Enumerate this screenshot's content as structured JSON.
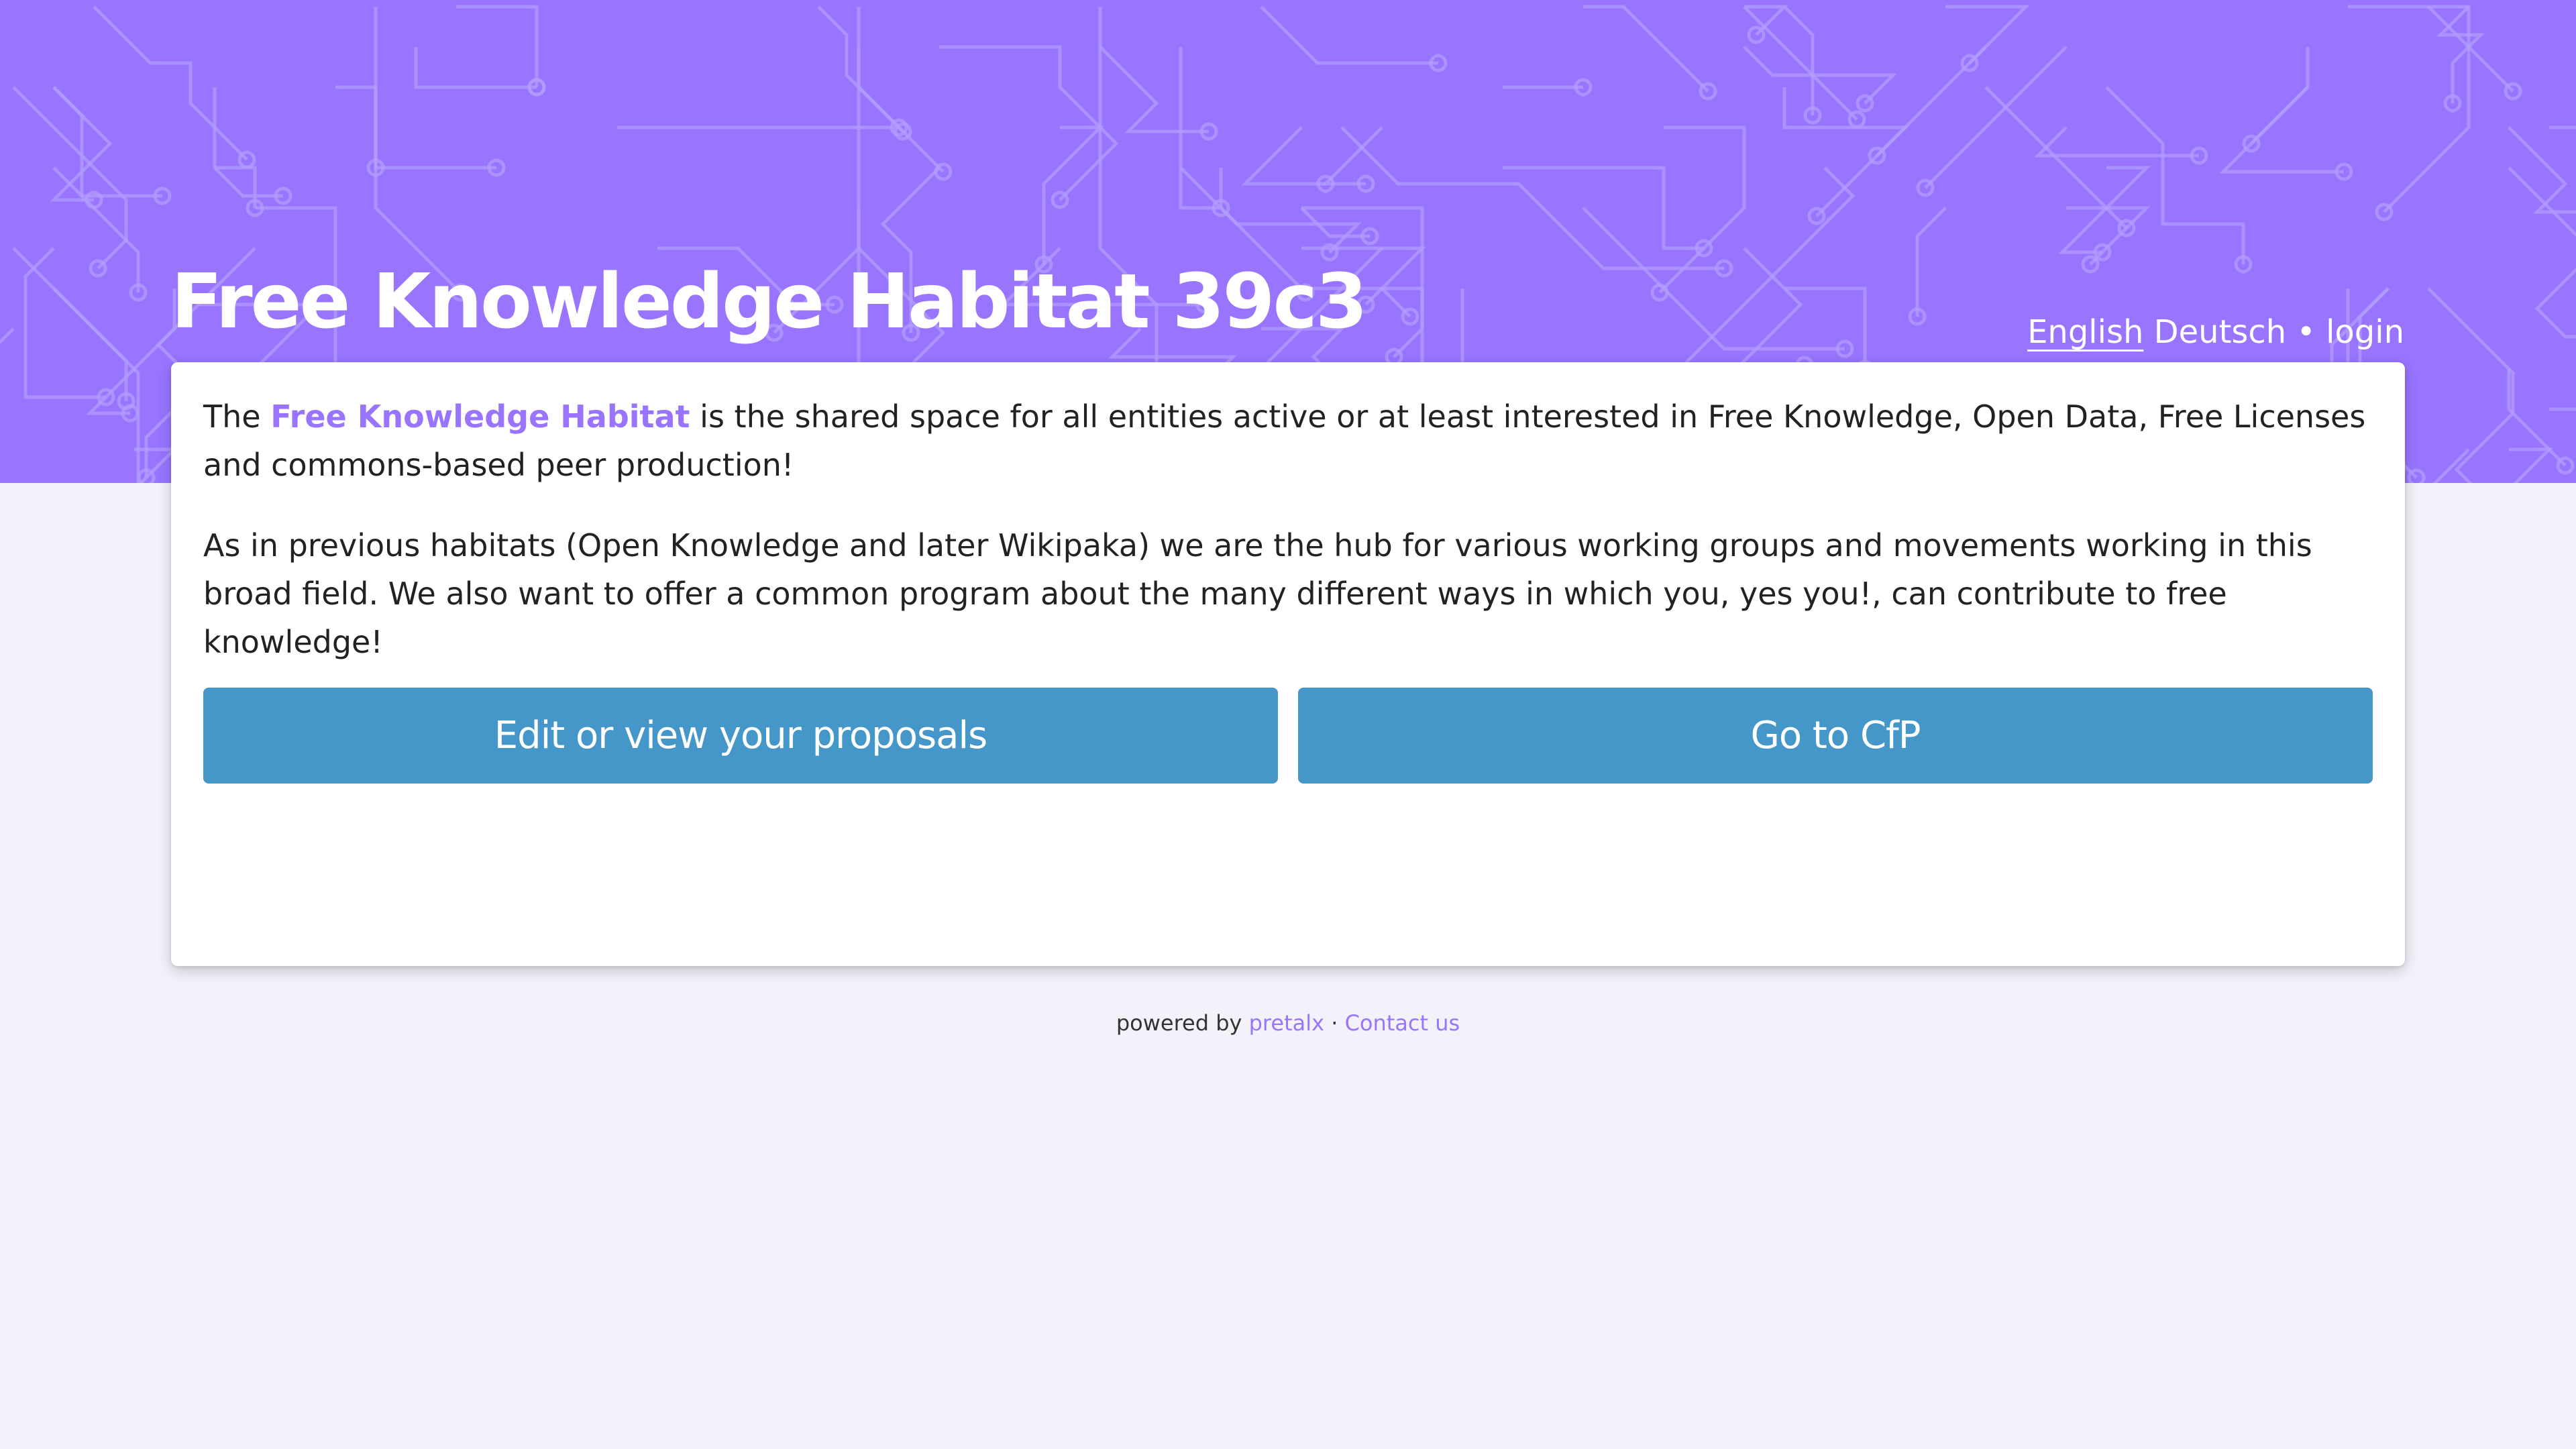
{
  "header": {
    "title": "Free Knowledge Habitat 39c3",
    "languages": [
      "English",
      "Deutsch"
    ],
    "separator": "•",
    "login_label": "login",
    "background_color": "#9874ff"
  },
  "intro": {
    "p1_prefix": "The ",
    "p1_link": "Free Knowledge Habitat",
    "p1_suffix": " is the shared space for all entities active or at least interested in Free Knowledge, Open Data, Free Licenses and commons-based peer production!",
    "p2": "As in previous habitats (Open Knowledge and later Wikipaka) we are the hub for various working groups and movements working in this broad field. We also want to offer a common program about the many different ways in which you, yes you!, can contribute to free knowledge!"
  },
  "buttons": {
    "proposals_label": "Edit or view your proposals",
    "cfp_label": "Go to CfP",
    "color": "#4697c9"
  },
  "footer": {
    "powered_by": "powered by ",
    "pretalx_label": "pretalx",
    "middot": " · ",
    "contact_label": "Contact us"
  },
  "colors": {
    "accent": "#9874ff",
    "page_background": "#f3f2fa"
  }
}
